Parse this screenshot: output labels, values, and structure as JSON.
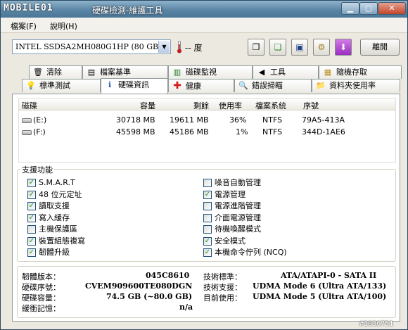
{
  "app": {
    "logo": "MOBILE01",
    "title": "硬碟檢測-維護工具"
  },
  "menus": [
    "檔案(F)",
    "說明(H)"
  ],
  "toolbar": {
    "drive": "INTEL SSDSA2MH080G1HP (80 GB)",
    "temperature": "-- 度",
    "exit_label": "離開"
  },
  "tabs_top": [
    {
      "label": "清除",
      "icon": "trash-icon"
    },
    {
      "label": "檔案基準",
      "icon": "file-benchmark-icon"
    },
    {
      "label": "磁碟監視",
      "icon": "chart-icon"
    },
    {
      "label": "工具",
      "icon": "speaker-icon"
    },
    {
      "label": "隨機存取",
      "icon": "random-access-icon"
    }
  ],
  "tabs_bottom": [
    {
      "label": "標準測試",
      "icon": "lightbulb-icon"
    },
    {
      "label": "硬碟資訊",
      "icon": "info-icon"
    },
    {
      "label": "健康",
      "icon": "health-cross-icon"
    },
    {
      "label": "錯誤掃瞄",
      "icon": "magnifier-icon"
    },
    {
      "label": "資料夾使用率",
      "icon": "folder-icon"
    }
  ],
  "volumes": {
    "headers": [
      "磁碟",
      "容量",
      "剩餘",
      "使用率",
      "檔案系統",
      "序號"
    ],
    "rows": [
      [
        "(E:)",
        "30718 MB",
        "19611 MB",
        "36%",
        "NTFS",
        "79A5-413A"
      ],
      [
        "(F:)",
        "45598 MB",
        "45186 MB",
        "1%",
        "NTFS",
        "344D-1AE6"
      ]
    ]
  },
  "features": {
    "title": "支援功能",
    "left": [
      {
        "label": "S.M.A.R.T",
        "checked": true
      },
      {
        "label": "48 位元定址",
        "checked": true
      },
      {
        "label": "讀取支援",
        "checked": true
      },
      {
        "label": "寫入緩存",
        "checked": true
      },
      {
        "label": "主機保護區",
        "checked": false
      },
      {
        "label": "裝置組態複寫",
        "checked": true
      },
      {
        "label": "韌體升級",
        "checked": true
      }
    ],
    "right": [
      {
        "label": "噪音自動管理",
        "checked": false
      },
      {
        "label": "電源管理",
        "checked": true
      },
      {
        "label": "電源進階管理",
        "checked": false
      },
      {
        "label": "介面電源管理",
        "checked": false
      },
      {
        "label": "待機喚醒模式",
        "checked": false
      },
      {
        "label": "安全模式",
        "checked": true
      },
      {
        "label": "本機命令佇列 (NCQ)",
        "checked": true
      }
    ]
  },
  "info": {
    "left": [
      {
        "label": "韌體版本：",
        "value": "045C8610"
      },
      {
        "label": "硬碟序號：",
        "value": "CVEM909600TE080DGN"
      },
      {
        "label": "硬碟容量：",
        "value": "74.5 GB (~80.0 GB)"
      },
      {
        "label": "緩衝記憶：",
        "value": "n/a"
      }
    ],
    "right": [
      {
        "label": "技術標準：",
        "value": "ATA/ATAPI-0 - SATA II"
      },
      {
        "label": "技術支援：",
        "value": "UDMA Mode 6 (Ultra ATA/133)"
      },
      {
        "label": "目前使用：",
        "value": "UDMA Mode 5 (Ultra ATA/100)"
      }
    ]
  },
  "watermark": "#1036751"
}
